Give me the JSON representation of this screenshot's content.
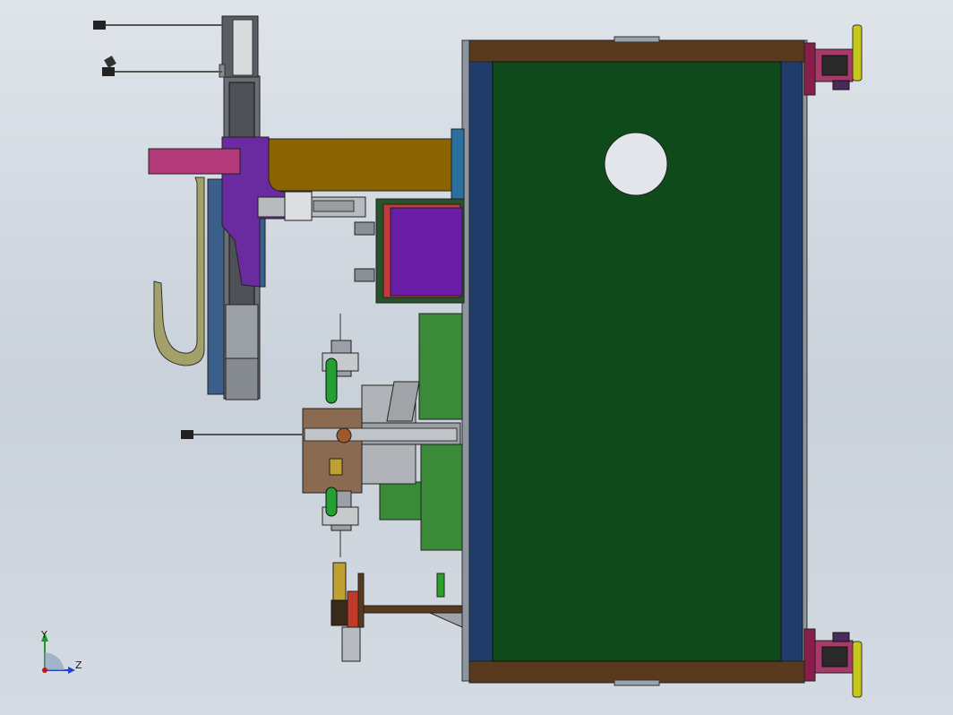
{
  "viewport": {
    "background_top": "#dfe4ea",
    "background_bottom": "#c9d1da"
  },
  "triad": {
    "y_label": "Y",
    "z_label": "Z",
    "y_color": "#1f9a2a",
    "z_color": "#2343c8",
    "origin_color": "#c01818"
  },
  "model": {
    "frame_color": "#5a3a1e",
    "panel_color": "#0f4a1a",
    "side_color": "#1f3c6a",
    "arm_color": "#8a6400",
    "bracket_color": "#6a2aa0",
    "plate_color": "#b23a7a",
    "foot_color": "#c8c81a"
  }
}
